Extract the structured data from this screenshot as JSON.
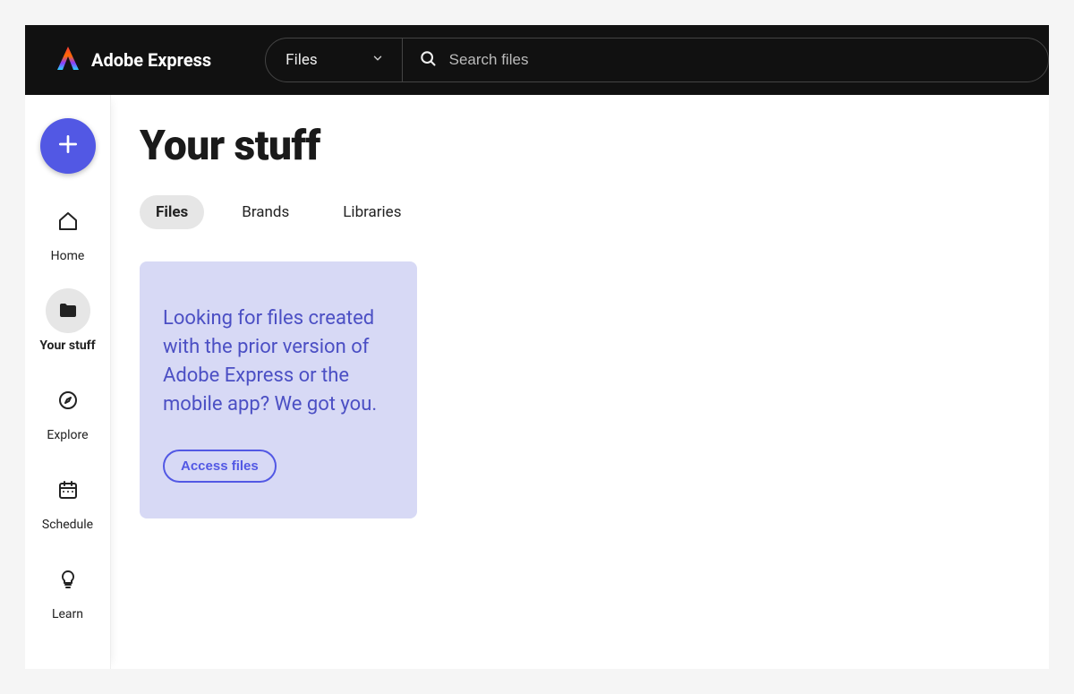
{
  "header": {
    "brand": "Adobe Express",
    "scope_label": "Files",
    "search_placeholder": "Search files"
  },
  "sidebar": {
    "items": [
      {
        "label": "Home"
      },
      {
        "label": "Your stuff"
      },
      {
        "label": "Explore"
      },
      {
        "label": "Schedule"
      },
      {
        "label": "Learn"
      }
    ]
  },
  "main": {
    "title": "Your stuff",
    "tabs": [
      {
        "label": "Files"
      },
      {
        "label": "Brands"
      },
      {
        "label": "Libraries"
      }
    ],
    "card": {
      "text": "Looking for files created with the prior version of Adobe Express or the mobile app? We got you.",
      "button": "Access files"
    }
  }
}
